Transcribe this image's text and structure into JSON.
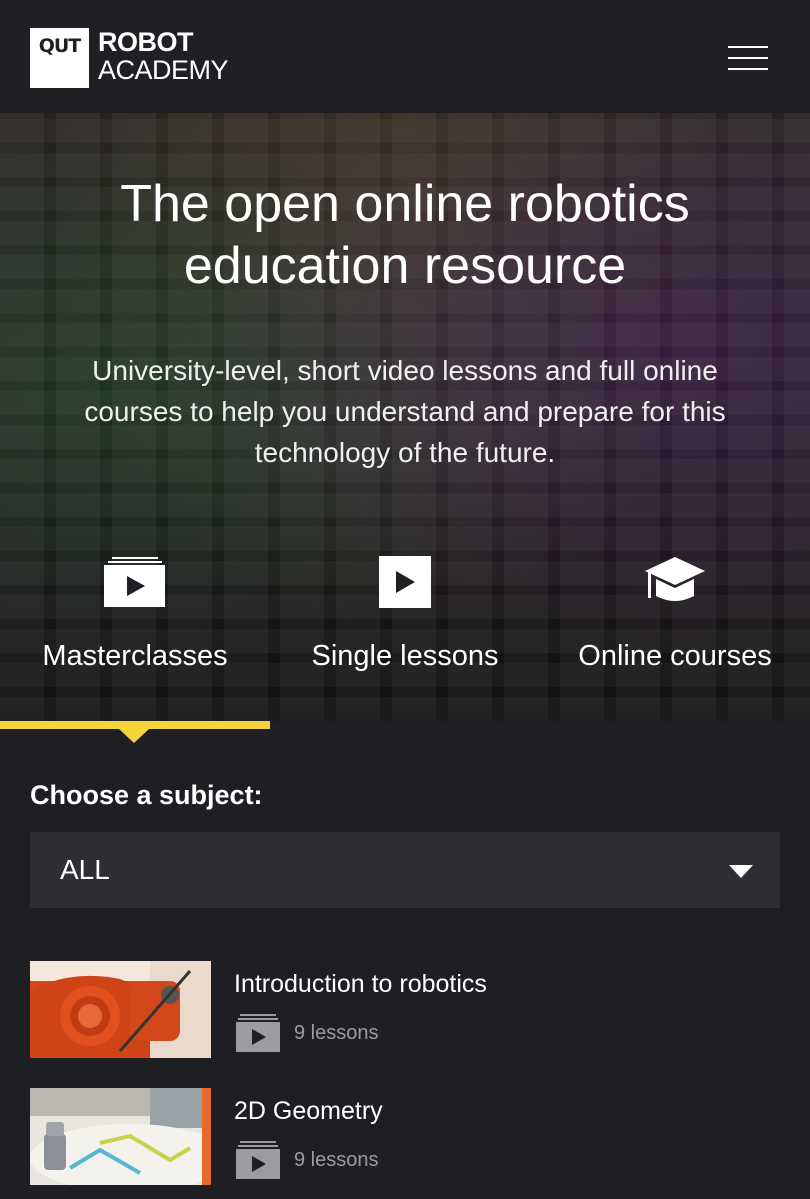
{
  "header": {
    "logo_qut": "QUT",
    "logo_line1": "ROBOT",
    "logo_line2": "ACADEMY",
    "menu_icon": "hamburger-menu-icon"
  },
  "hero": {
    "title_line1": "The open online robotics",
    "title_line2": "education resource",
    "subtitle_line1": "University-level, short video lessons and full online",
    "subtitle_line2": "courses to help you understand and prepare for this",
    "subtitle_line3": "technology of the future."
  },
  "categories": [
    {
      "label": "Masterclasses",
      "icon": "stacked-play-icon"
    },
    {
      "label": "Single lessons",
      "icon": "play-icon"
    },
    {
      "label": "Online courses",
      "icon": "graduation-cap-icon"
    }
  ],
  "subject": {
    "label": "Choose a subject:",
    "selected": "ALL"
  },
  "courses": [
    {
      "title": "Introduction to robotics",
      "count": "9 lessons"
    },
    {
      "title": "2D Geometry",
      "count": "9 lessons"
    }
  ],
  "colors": {
    "accent": "#f5d33b",
    "background": "#1e1f22",
    "select_bg": "#2e2f34",
    "muted": "#9a9ca2"
  }
}
